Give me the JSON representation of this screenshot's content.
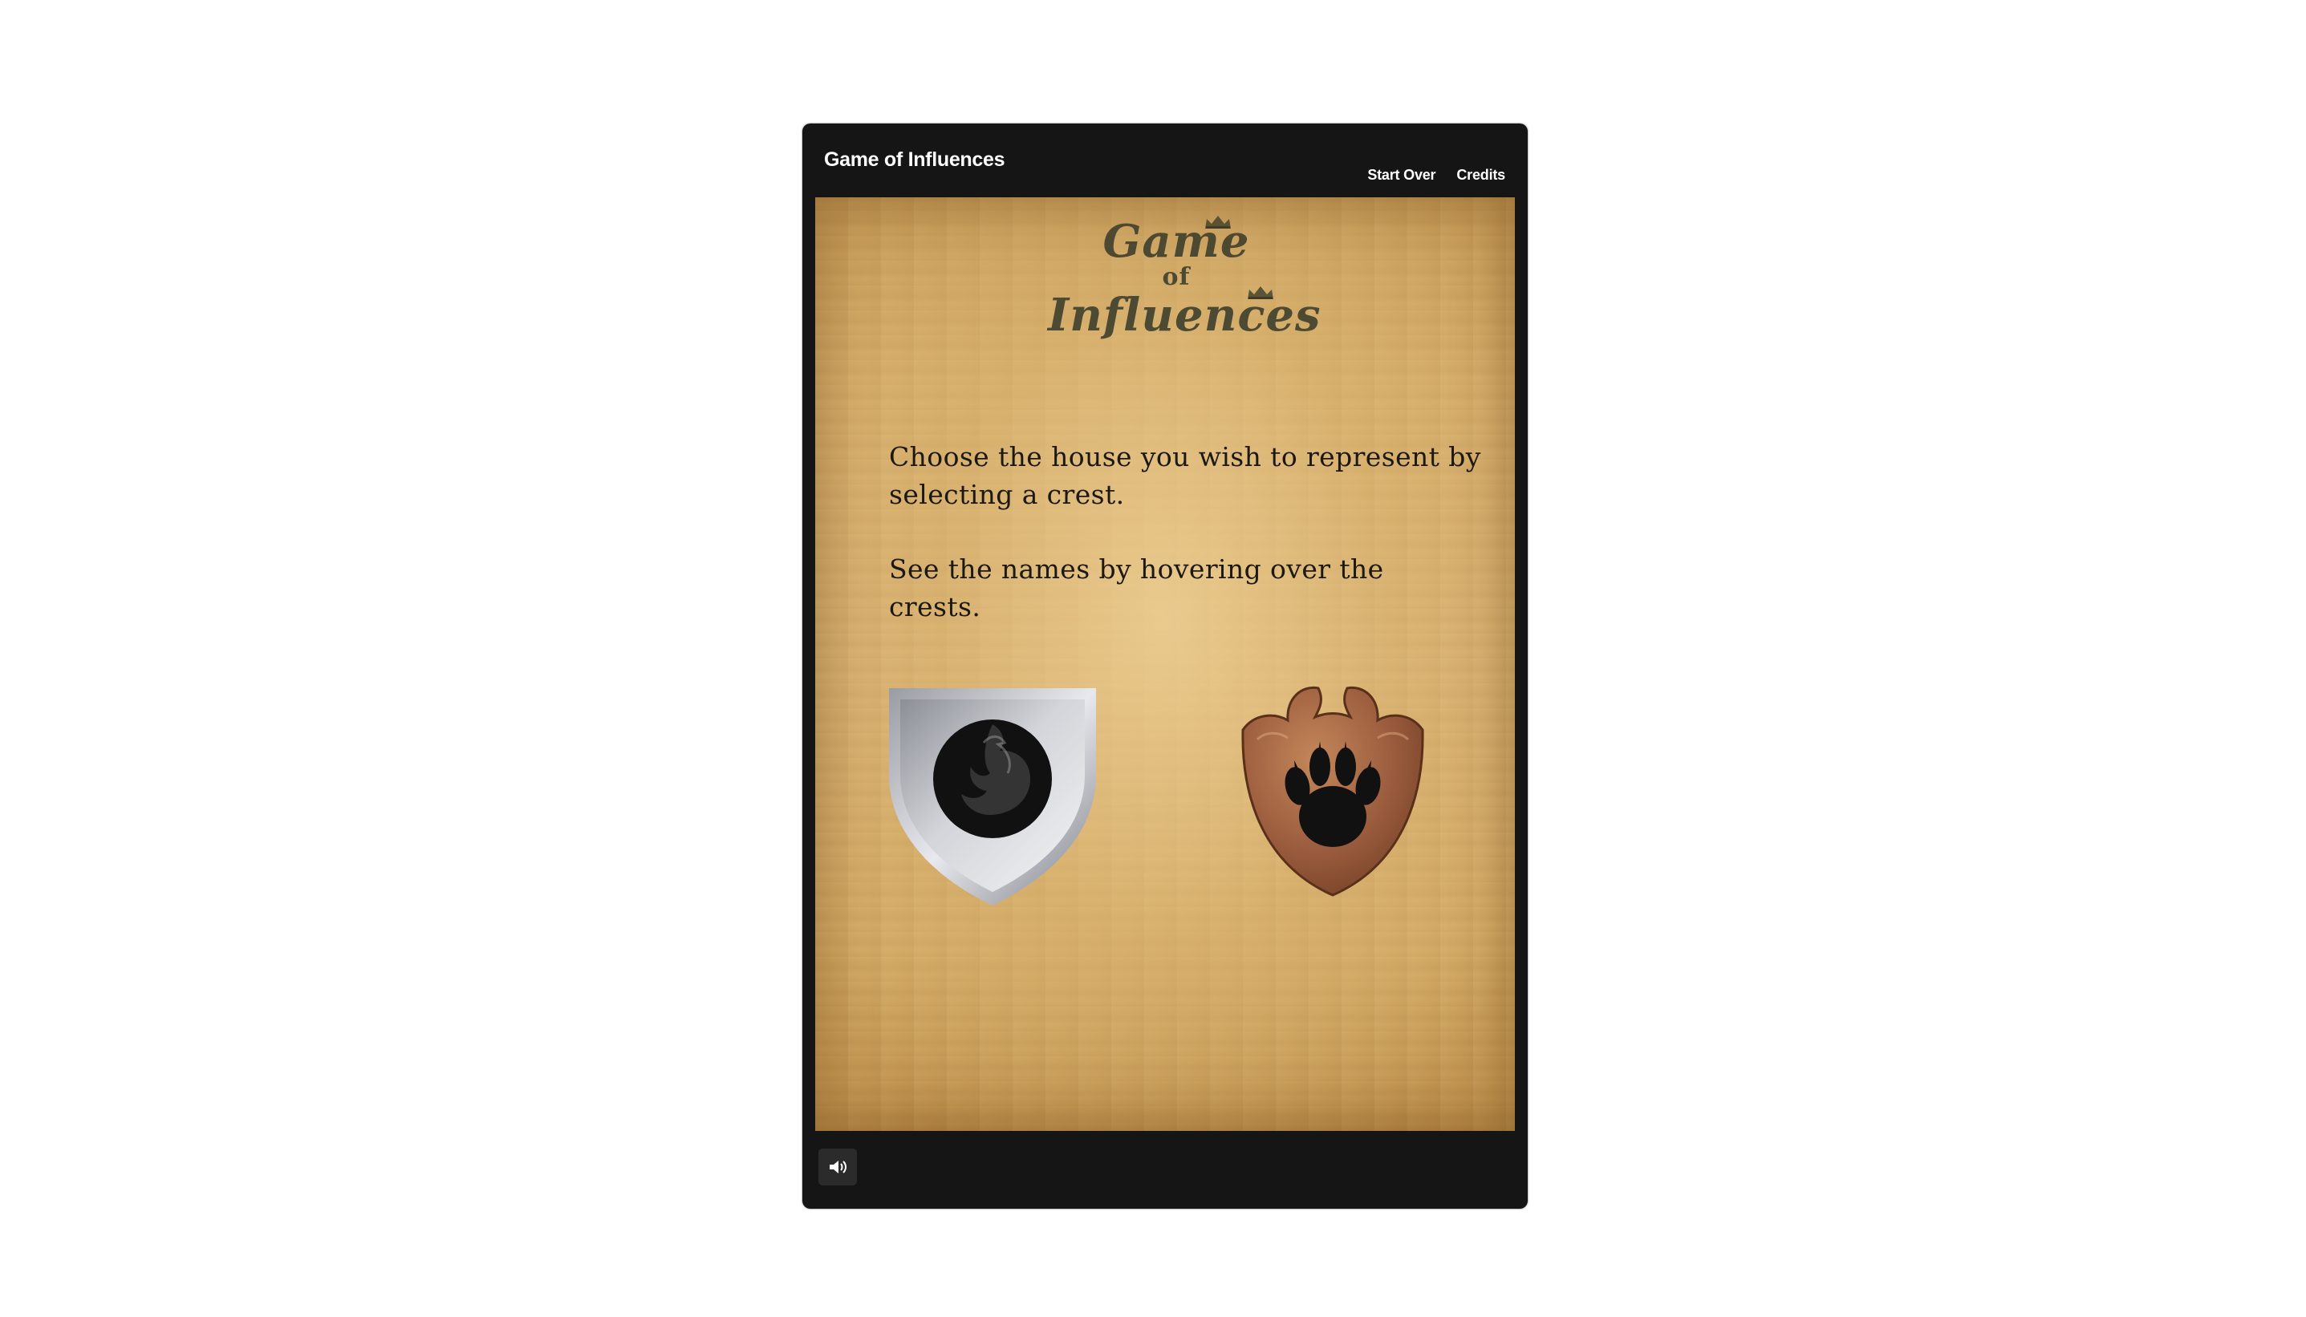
{
  "app": {
    "title": "Game of Influences"
  },
  "nav": {
    "start_over": "Start Over",
    "credits": "Credits"
  },
  "logo": {
    "line1": "Game",
    "line2": "of",
    "line3": "Influences",
    "color": "#4d4a33"
  },
  "instructions": {
    "line1": "Choose the house you wish to represent by selecting a crest.",
    "line2": "See the names by hovering over the crests."
  },
  "crests": [
    {
      "icon": "dragon-shield-icon",
      "metal": "silver"
    },
    {
      "icon": "paw-shield-icon",
      "metal": "bronze"
    }
  ],
  "controls": {
    "sound_icon": "speaker-icon"
  },
  "colors": {
    "frame": "#151515",
    "parchment": "#d9b274",
    "text": "#1c1812"
  }
}
